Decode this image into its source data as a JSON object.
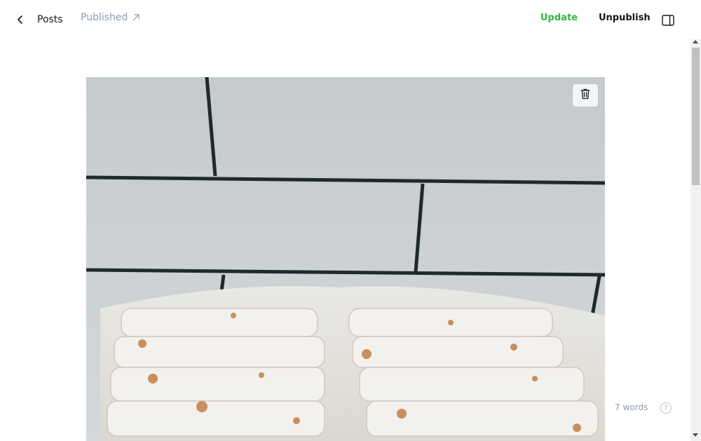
{
  "header": {
    "back_label": "Posts",
    "status_label": "Published",
    "update_label": "Update",
    "unpublish_label": "Unpublish"
  },
  "editor": {
    "word_count": "7 words",
    "help_glyph": "?"
  },
  "colors": {
    "accent_green": "#30cf43",
    "muted_text": "#8e9cac"
  },
  "icons": [
    "chevron-left-icon",
    "arrow-up-right-icon",
    "sidebar-panel-icon",
    "trash-icon",
    "help-icon"
  ]
}
